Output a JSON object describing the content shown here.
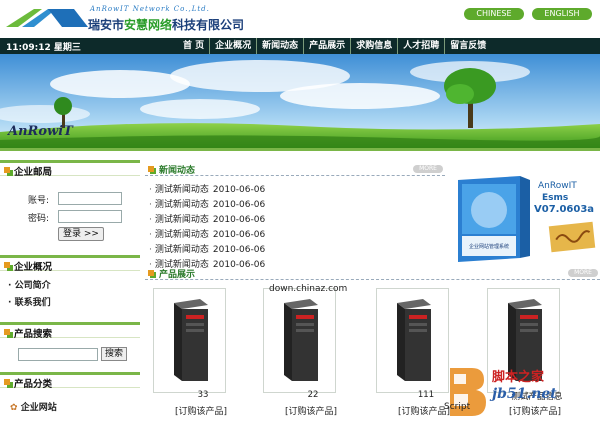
{
  "header": {
    "logo_en": "AnRowIT Network Co.,Ltd.",
    "logo_cn_pre": "瑞安市",
    "logo_cn_hl": "安慧网络",
    "logo_cn_post": "科技有限公司",
    "lang_cn": "CHINESE",
    "lang_en": "ENGLISH"
  },
  "navbar": {
    "clock": "11:09:12 星期三",
    "items": [
      "首 页",
      "企业概况",
      "新闻动态",
      "产品展示",
      "求购信息",
      "人才招聘",
      "留言反馈"
    ]
  },
  "banner": {
    "logo_text": "AnRowiT"
  },
  "sidebar": {
    "mail_title": "企业邮局",
    "account_label": "账号:",
    "password_label": "密码:",
    "login_button": "登录 >>",
    "profile_title": "企业概况",
    "profile_links": [
      "公司简介",
      "联系我们"
    ],
    "search_title": "产品搜索",
    "search_button": "搜索",
    "category_title": "产品分类",
    "category_links": [
      "企业网站"
    ]
  },
  "news": {
    "title": "新闻动态",
    "more": "MORE",
    "items": [
      {
        "title": "测试新闻动态",
        "date": "2010-06-06"
      },
      {
        "title": "测试新闻动态",
        "date": "2010-06-06"
      },
      {
        "title": "测试新闻动态",
        "date": "2010-06-06"
      },
      {
        "title": "测试新闻动态",
        "date": "2010-06-06"
      },
      {
        "title": "测试新闻动态",
        "date": "2010-06-06"
      },
      {
        "title": "测试新闻动态",
        "date": "2010-06-06"
      }
    ]
  },
  "ad": {
    "brand": "AnRowIT",
    "product": "Esms",
    "version": "V07.0603a",
    "box_text": "企业网站管理系统"
  },
  "products": {
    "title": "产品展示",
    "more": "MORE",
    "items": [
      {
        "name": "33",
        "order": "[订购该产品]"
      },
      {
        "name": "22",
        "order": "[订购该产品]"
      },
      {
        "name": "111",
        "order": "[订购该产品]"
      },
      {
        "name": "测试产品信息",
        "order": "[订购该产品]"
      }
    ]
  },
  "overlay": {
    "chinaz": "down.chinaz.com",
    "script_label": "Script",
    "site_cn": "脚本之家",
    "site_en": "jb51.net"
  },
  "colors": {
    "accent_green": "#7ab648",
    "nav_bg": "#0d2a2a",
    "orange": "#e59a1f"
  }
}
